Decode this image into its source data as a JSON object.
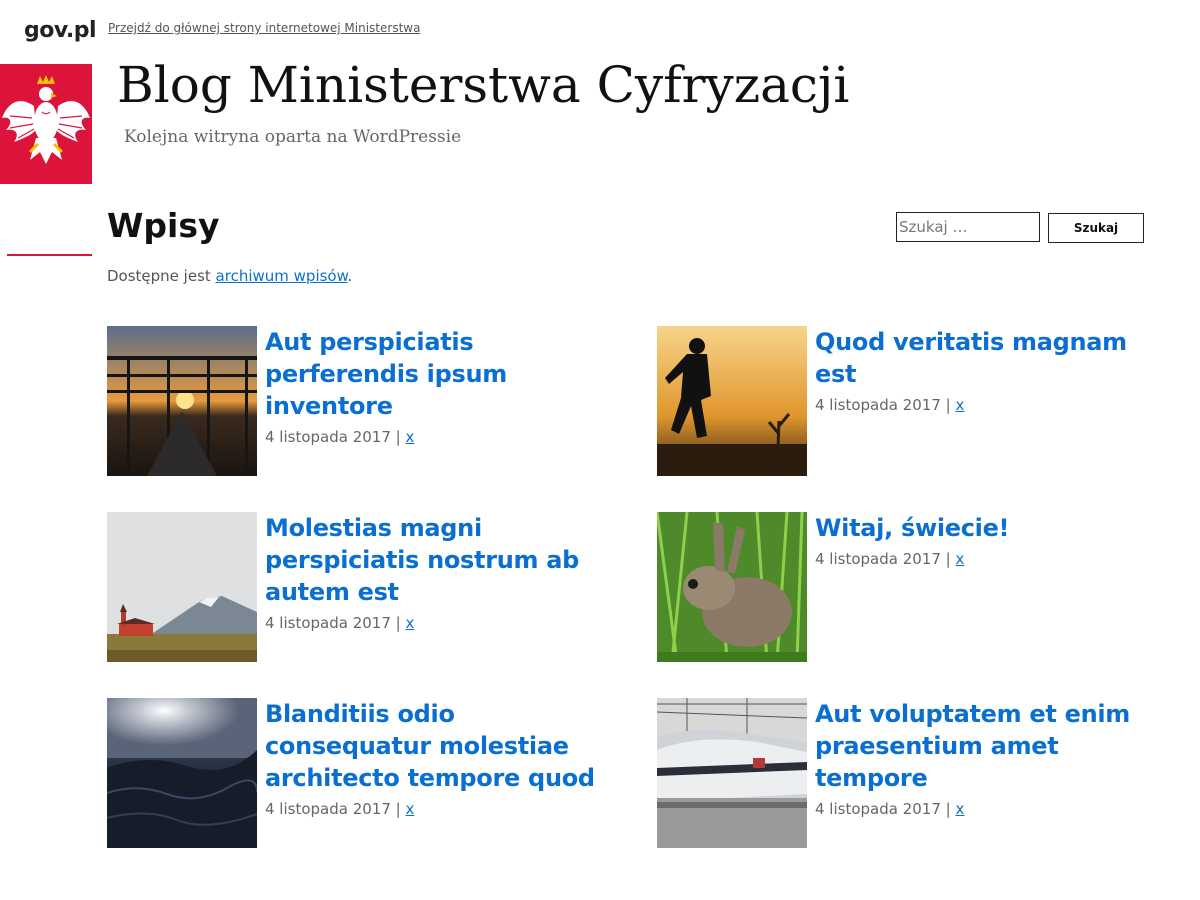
{
  "top": {
    "brand": "gov.pl",
    "skip_link": "Przejdź do głównej strony internetowej Ministerstwa"
  },
  "header": {
    "title": "Blog Ministerstwa Cyfryzacji",
    "description": "Kolejna witryna oparta na WordPressie"
  },
  "main": {
    "title": "Wpisy",
    "intro_prefix": "Dostępne jest ",
    "intro_link": "archiwum wpisów",
    "intro_suffix": "."
  },
  "search": {
    "placeholder": "Szukaj …",
    "button": "Szukaj"
  },
  "posts": [
    {
      "title": "Aut perspiciatis perferendis ipsum inventore",
      "date": "4 listopada 2017",
      "separator": " | ",
      "tag": "x",
      "image": "sunset-bridge"
    },
    {
      "title": "Quod veritatis magnam est",
      "date": "4 listopada 2017",
      "separator": " | ",
      "tag": "x",
      "image": "runner-silhouette"
    },
    {
      "title": "Molestias magni perspiciatis nostrum ab autem est",
      "date": "4 listopada 2017",
      "separator": " | ",
      "tag": "x",
      "image": "church-landscape"
    },
    {
      "title": "Witaj, świecie!",
      "date": "4 listopada 2017",
      "separator": " | ",
      "tag": "x",
      "image": "rabbit-grass"
    },
    {
      "title": "Blanditiis odio consequatur molestiae architecto tempore quod",
      "date": "4 listopada 2017",
      "separator": " | ",
      "tag": "x",
      "image": "sea-waves"
    },
    {
      "title": "Aut voluptatem et enim praesentium amet tempore",
      "date": "4 listopada 2017",
      "separator": " | ",
      "tag": "x",
      "image": "train-station"
    }
  ],
  "colors": {
    "accent": "#0b6fd1",
    "emblem_red": "#dc143c"
  }
}
